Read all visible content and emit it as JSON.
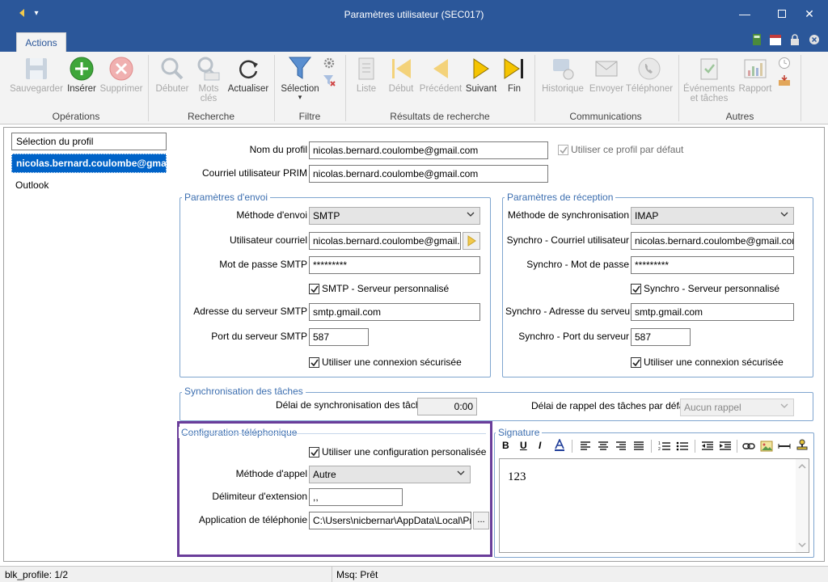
{
  "window": {
    "title": "Paramètres utilisateur (SEC017)"
  },
  "ribbon": {
    "tab": "Actions",
    "groups": {
      "operations": "Opérations",
      "recherche": "Recherche",
      "filtre": "Filtre",
      "resultats": "Résultats de recherche",
      "communications": "Communications",
      "autres": "Autres"
    },
    "buttons": {
      "sauvegarder": "Sauvegarder",
      "inserer": "Insérer",
      "supprimer": "Supprimer",
      "debuter": "Débuter",
      "mots": "Mots",
      "cles": "clés",
      "actualiser": "Actualiser",
      "selection": "Sélection",
      "liste": "Liste",
      "debut": "Début",
      "precedent": "Précédent",
      "suivant": "Suivant",
      "fin": "Fin",
      "historique": "Historique",
      "envoyer": "Envoyer",
      "telephoner": "Téléphoner",
      "evenements": "Événements",
      "et_taches": "et tâches",
      "rapport": "Rapport"
    }
  },
  "profiles": {
    "header": "Sélection du profil",
    "items": [
      "nicolas.bernard.coulombe@gmail",
      "Outlook"
    ]
  },
  "form": {
    "nom_profil_label": "Nom du profil",
    "nom_profil_value": "nicolas.bernard.coulombe@gmail.com",
    "courriel_label": "Courriel utilisateur PRIM",
    "courriel_value": "nicolas.bernard.coulombe@gmail.com",
    "default_profile_label": "Utiliser ce profil par défaut"
  },
  "envoi": {
    "legend": "Paramètres d'envoi",
    "methode_label": "Méthode d'envoi",
    "methode_value": "SMTP",
    "utilisateur_label": "Utilisateur courriel",
    "utilisateur_value": "nicolas.bernard.coulombe@gmail.com",
    "mdp_label": "Mot de passe SMTP",
    "mdp_value": "*********",
    "perso_label": "SMTP - Serveur personnalisé",
    "adresse_label": "Adresse du serveur SMTP",
    "adresse_value": "smtp.gmail.com",
    "port_label": "Port du serveur SMTP",
    "port_value": "587",
    "secure_label": "Utiliser une connexion sécurisée"
  },
  "reception": {
    "legend": "Paramètres de réception",
    "methode_label": "Méthode de synchronisation",
    "methode_value": "IMAP",
    "utilisateur_label": "Synchro - Courriel utilisateur",
    "utilisateur_value": "nicolas.bernard.coulombe@gmail.com",
    "mdp_label": "Synchro - Mot de passe",
    "mdp_value": "*********",
    "perso_label": "Synchro - Serveur personnalisé",
    "adresse_label": "Synchro - Adresse du serveur",
    "adresse_value": "smtp.gmail.com",
    "port_label": "Synchro - Port du serveur",
    "port_value": "587",
    "secure_label": "Utiliser une connexion sécurisée"
  },
  "taches": {
    "legend": "Synchronisation des tâches",
    "delai_label": "Délai de synchronisation des tâches",
    "delai_value": "0:00",
    "rappel_label": "Délai de rappel des tâches par défaut",
    "rappel_value": "Aucun rappel"
  },
  "telephonie": {
    "legend": "Configuration téléphonique",
    "use_label": "Utiliser une configuration personalisée",
    "methode_label": "Méthode d'appel",
    "methode_value": "Autre",
    "delim_label": "Délimiteur d'extension",
    "delim_value": ",,",
    "app_label": "Application de téléphonie",
    "app_value": "C:\\Users\\nicbernar\\AppData\\Local\\Progr",
    "browse_label": "..."
  },
  "signature": {
    "legend": "Signature",
    "content": "123"
  },
  "status": {
    "left": "blk_profile: 1/2",
    "msg": "Msq: Prêt"
  },
  "colors": {
    "titlebar": "#2b579a",
    "accent": "#3d6fb0",
    "selection": "#0063c8",
    "highlight_border": "#6a3d9a"
  }
}
